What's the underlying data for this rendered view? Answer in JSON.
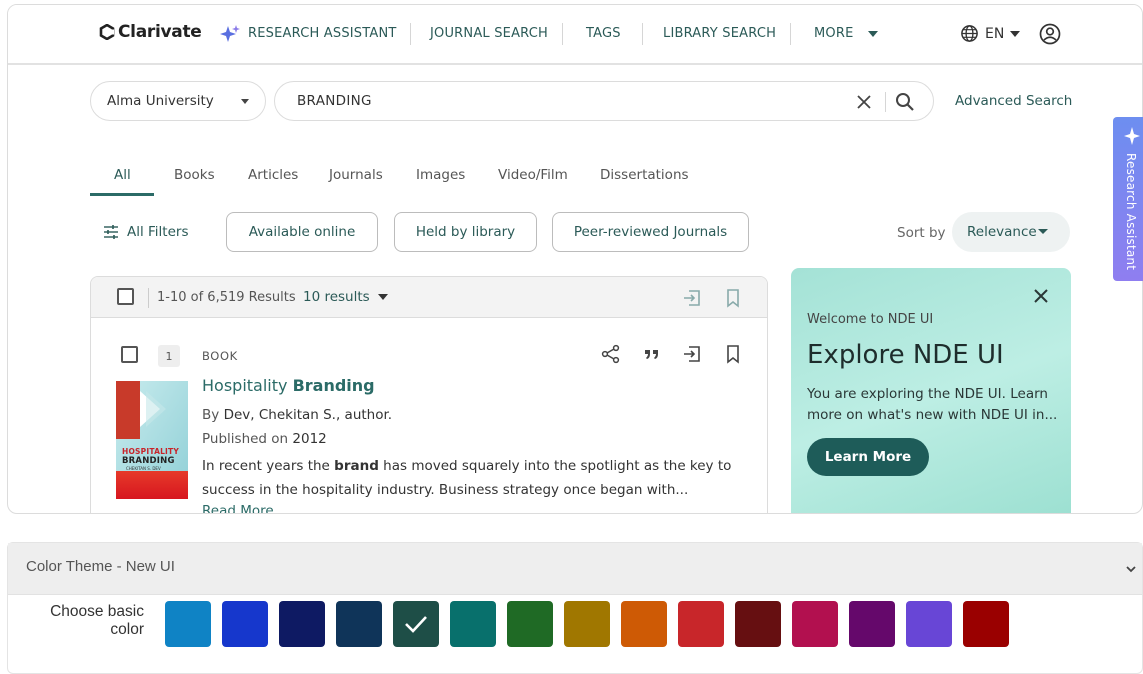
{
  "brand": {
    "name": "Clarivate"
  },
  "nav": {
    "research_assistant": "RESEARCH ASSISTANT",
    "journal_search": "JOURNAL SEARCH",
    "tags": "TAGS",
    "library_search": "LIBRARY SEARCH",
    "more": "MORE",
    "language": "EN"
  },
  "search": {
    "institution": "Alma University",
    "query": "BRANDING",
    "advanced": "Advanced Search"
  },
  "tabs": [
    "All",
    "Books",
    "Articles",
    "Journals",
    "Images",
    "Video/Film",
    "Dissertations"
  ],
  "filters": {
    "all_filters": "All Filters",
    "chips": [
      "Available online",
      "Held by library",
      "Peer-reviewed Journals"
    ],
    "sort_label": "Sort by",
    "sort_value": "Relevance"
  },
  "results": {
    "count": "1-10 of 6,519 Results",
    "per_page": "10 results"
  },
  "record": {
    "number": "1",
    "type": "BOOK",
    "title_prefix": "Hospitality ",
    "title_highlight": "Branding",
    "by_label": "By",
    "author": "Dev, Chekitan S., author.",
    "published_label": "Published on",
    "year": "2012",
    "abstract_before": "In recent years the ",
    "abstract_highlight": "brand",
    "abstract_after": " has moved squarely into the spotlight as the key to success in the hospitality industry. Business strategy once began with...",
    "read_more": "Read More",
    "cover_title_1": "HOSPITALITY",
    "cover_title_2": "BRANDING",
    "cover_author": "CHEKITAN S. DEV"
  },
  "promo": {
    "welcome": "Welcome to NDE UI",
    "title": "Explore NDE UI",
    "body": "You are exploring the NDE UI. Learn more on what's new with NDE UI in...",
    "button": "Learn More"
  },
  "side_tab": {
    "label": "Research Assistant"
  },
  "theme": {
    "title": "Color Theme - New UI",
    "choose_label_1": "Choose basic",
    "choose_label_2": "color",
    "swatches": [
      "#0f83c5",
      "#1637cc",
      "#0e1a63",
      "#0f3459",
      "#1e4e47",
      "#08706c",
      "#1f6a25",
      "#a07700",
      "#ce5a05",
      "#c8262a",
      "#660f11",
      "#b2104f",
      "#65086b",
      "#6846d6",
      "#9a0000"
    ],
    "selected_index": 4
  },
  "colors": {
    "accent": "#2b6b67",
    "promo_button": "#1e5c59"
  }
}
